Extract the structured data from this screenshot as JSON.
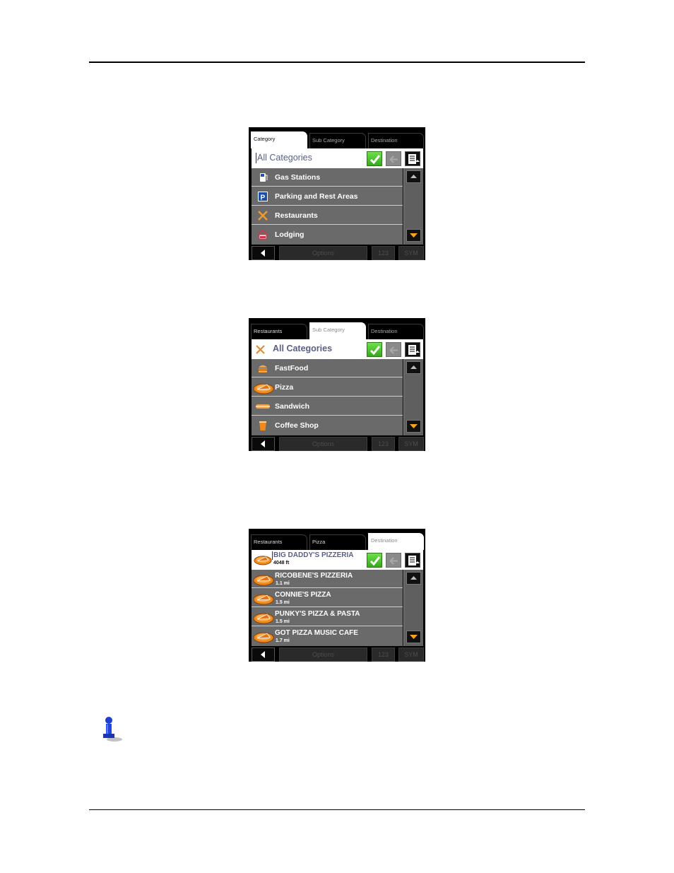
{
  "screens": [
    {
      "tabs": [
        {
          "label": "Category",
          "active": true
        },
        {
          "label": "Sub Category",
          "active": false
        },
        {
          "label": "Destination",
          "active": false
        }
      ],
      "header": {
        "text": "All Categories",
        "icon": null
      },
      "items": [
        {
          "label": "Gas Stations",
          "icon": "gas-pump-icon"
        },
        {
          "label": "Parking and Rest Areas",
          "icon": "parking-icon"
        },
        {
          "label": "Restaurants",
          "icon": "fork-knife-icon"
        },
        {
          "label": "Lodging",
          "icon": "bed-icon"
        }
      ],
      "bottom": {
        "options": "Options",
        "numbers": "123",
        "symbols": "SYM"
      }
    },
    {
      "tabs": [
        {
          "label": "Restaurants",
          "active": false
        },
        {
          "label": "Sub Category",
          "active": true
        },
        {
          "label": "Destination",
          "active": false
        }
      ],
      "header": {
        "text": "All Categories",
        "icon": "fork-knife-icon"
      },
      "items": [
        {
          "label": "FastFood",
          "icon": "burger-icon"
        },
        {
          "label": "Pizza",
          "icon": "pizza-icon"
        },
        {
          "label": "Sandwich",
          "icon": "sandwich-icon"
        },
        {
          "label": "Coffee Shop",
          "icon": "coffee-cup-icon"
        }
      ],
      "bottom": {
        "options": "Options",
        "numbers": "123",
        "symbols": "SYM"
      }
    },
    {
      "tabs": [
        {
          "label": "Restaurants",
          "active": false
        },
        {
          "label": "Pizza",
          "active": false
        },
        {
          "label": "Destination",
          "active": true
        }
      ],
      "header": {
        "name": "BIG DADDY'S PIZZERIA",
        "distance": "4048 ft",
        "icon": "pizza-icon"
      },
      "items": [
        {
          "name": "RICOBENE'S PIZZERIA",
          "distance": "1.1 mi"
        },
        {
          "name": "CONNIE'S PIZZA",
          "distance": "1.5 mi"
        },
        {
          "name": "PUNKY'S PIZZA & PASTA",
          "distance": "1.5 mi"
        },
        {
          "name": "GOT PIZZA MUSIC CAFE",
          "distance": "1.7 mi"
        }
      ],
      "bottom": {
        "options": "Options",
        "numbers": "123",
        "symbols": "SYM"
      }
    }
  ],
  "colors": {
    "ok_green": "#4cc42e",
    "header_text": "#5a5f87",
    "list_bg": "#6a6a6a",
    "accent_orange": "#f08a1c"
  }
}
